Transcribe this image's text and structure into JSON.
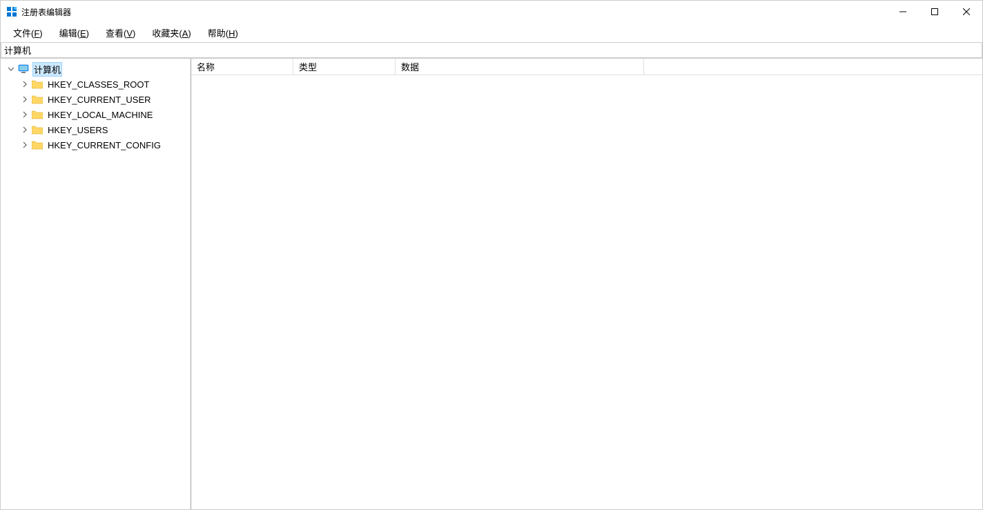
{
  "window": {
    "title": "注册表编辑器"
  },
  "menu": {
    "file": "文件(F)",
    "edit": "编辑(E)",
    "view": "查看(V)",
    "favorites": "收藏夹(A)",
    "help": "帮助(H)"
  },
  "address": "计算机",
  "tree": {
    "root": "计算机",
    "hives": [
      "HKEY_CLASSES_ROOT",
      "HKEY_CURRENT_USER",
      "HKEY_LOCAL_MACHINE",
      "HKEY_USERS",
      "HKEY_CURRENT_CONFIG"
    ]
  },
  "columns": {
    "name": "名称",
    "type": "类型",
    "data": "数据"
  }
}
